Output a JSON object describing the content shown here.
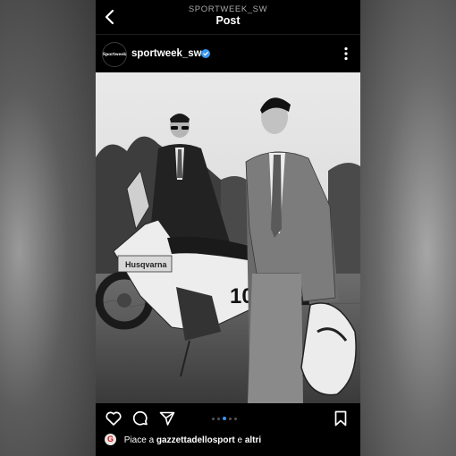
{
  "nav": {
    "account_caption": "SPORTWEEK_SW",
    "title": "Post",
    "back_icon": "chevron-left-icon"
  },
  "post": {
    "avatar_text": "Sportweek",
    "username": "sportweek_sw",
    "verified_icon": "verified-badge-icon",
    "more_icon": "more-vertical-icon",
    "image_alt": "Black and white photo of two men in suits standing beside a Husqvarna dirt bike in a field",
    "bike_brand_text": "Husqvarna",
    "bike_number": "10",
    "carousel": {
      "count": 5,
      "active_index": 2
    }
  },
  "actions": {
    "like_icon": "heart-icon",
    "comment_icon": "comment-bubble-icon",
    "share_icon": "paper-plane-icon",
    "save_icon": "bookmark-icon"
  },
  "likes": {
    "avatar_glyph": "G",
    "prefix": "Piace a",
    "user": "gazzettadellosport",
    "connector": "e",
    "suffix": "altri"
  },
  "colors": {
    "background": "#000000",
    "text": "#ffffff",
    "secondary_text": "#a8a8a8",
    "verified_blue": "#3897f0",
    "carousel_active": "#3897f0"
  }
}
